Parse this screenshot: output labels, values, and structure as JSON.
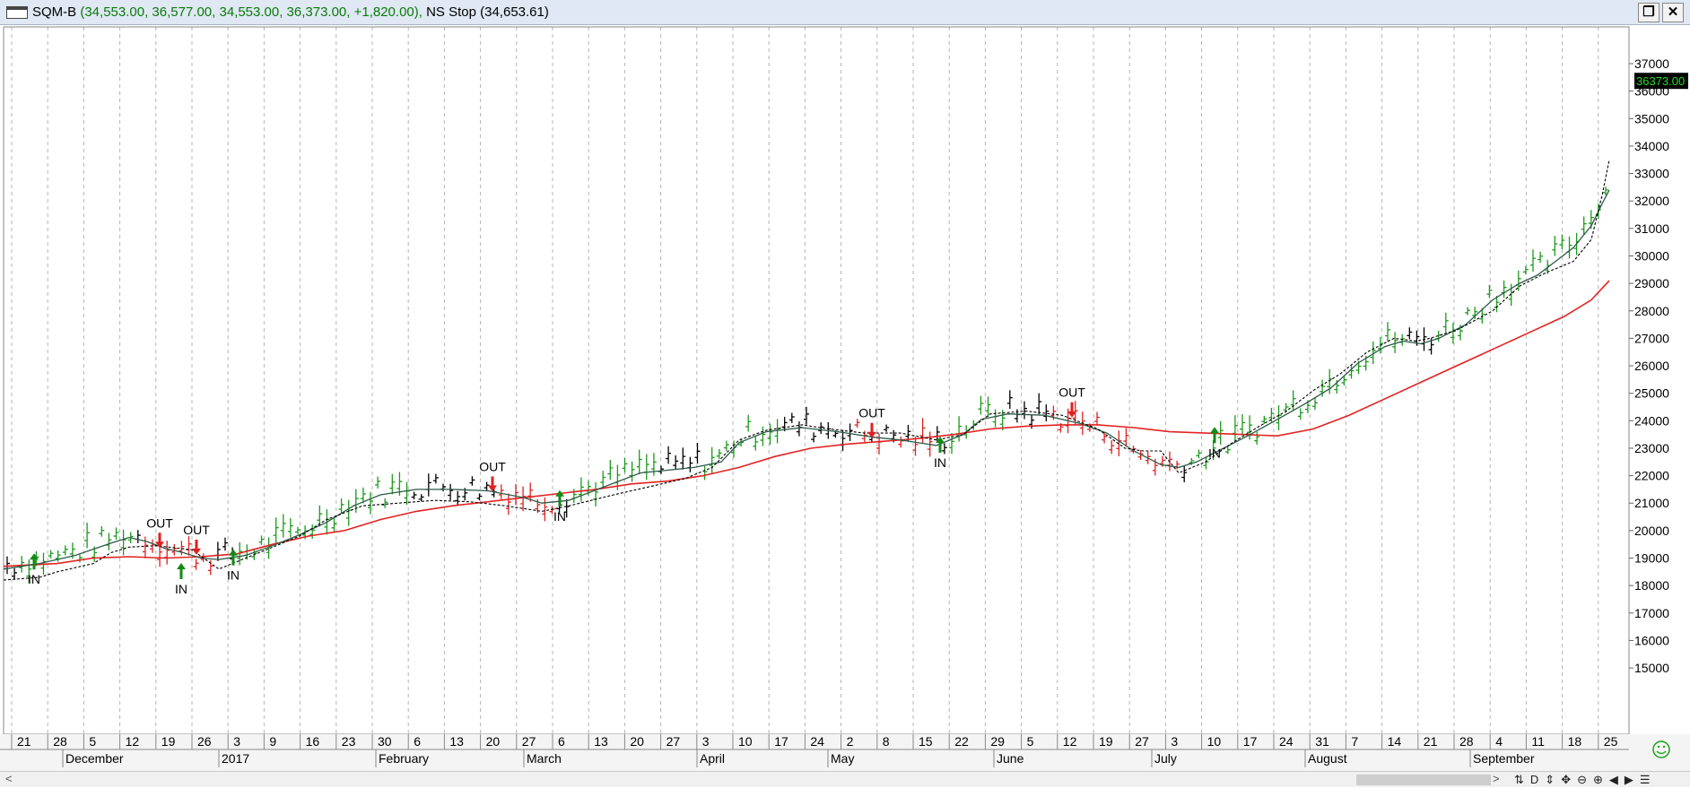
{
  "window": {
    "symbol": "SQM-B",
    "ohlc": "(34,553.00, 36,577.00, 34,553.00, 36,373.00, +1,820.00),",
    "indicator": "NS Stop (34,653.61)",
    "restore_icon": "restore-icon",
    "close_icon": "close-icon"
  },
  "colors": {
    "up_bar": "#1a9a1a",
    "down_bar": "#e02020",
    "neutral_bar": "#000000",
    "ma_long": "#e32222",
    "ma_short": "#2d5a4a",
    "stop_line": "#000000",
    "signal_in": "#138a13",
    "signal_out": "#e02020",
    "last_price_bg": "#000000",
    "last_price_fg": "#22dd22",
    "grid": "#b4b4b4"
  },
  "price_axis": {
    "labels": [
      "15000",
      "16000",
      "17000",
      "18000",
      "19000",
      "20000",
      "21000",
      "22000",
      "23000",
      "24000",
      "25000",
      "26000",
      "27000",
      "28000",
      "29000",
      "30000",
      "31000",
      "32000",
      "33000",
      "34000",
      "35000",
      "36000",
      "37000"
    ],
    "last_price_label": "36373.00"
  },
  "time_axis": {
    "day_labels": [
      "21",
      "28",
      "5",
      "12",
      "19",
      "26",
      "3",
      "9",
      "16",
      "23",
      "30",
      "6",
      "13",
      "20",
      "27",
      "6",
      "13",
      "20",
      "27",
      "3",
      "10",
      "17",
      "24",
      "2",
      "8",
      "15",
      "22",
      "29",
      "5",
      "12",
      "19",
      "27",
      "3",
      "10",
      "17",
      "24",
      "31",
      "7",
      "14",
      "21",
      "28",
      "4",
      "11",
      "18",
      "25"
    ],
    "month_labels": [
      "December",
      "2017",
      "February",
      "March",
      "April",
      "May",
      "June",
      "July",
      "August",
      "September"
    ]
  },
  "signals": [
    {
      "type": "IN",
      "label": "IN",
      "x": 34,
      "y": 18650
    },
    {
      "type": "OUT",
      "label": "OUT",
      "x": 174,
      "y": 19400
    },
    {
      "type": "IN",
      "label": "IN",
      "x": 198,
      "y": 18300
    },
    {
      "type": "OUT",
      "label": "OUT",
      "x": 215,
      "y": 19150
    },
    {
      "type": "IN",
      "label": "IN",
      "x": 256,
      "y": 18800
    },
    {
      "type": "OUT",
      "label": "OUT",
      "x": 545,
      "y": 21450
    },
    {
      "type": "IN",
      "label": "IN",
      "x": 620,
      "y": 20950
    },
    {
      "type": "OUT",
      "label": "OUT",
      "x": 968,
      "y": 23400
    },
    {
      "type": "IN",
      "label": "IN",
      "x": 1044,
      "y": 22900
    },
    {
      "type": "OUT",
      "label": "OUT",
      "x": 1191,
      "y": 24150
    },
    {
      "type": "IN",
      "label": "IN",
      "x": 1350,
      "y": 23250
    }
  ],
  "chart_data": {
    "type": "bar",
    "title": "SQM-B",
    "y_range": [
      14400,
      37300
    ],
    "x_range": [
      0,
      1818
    ],
    "ma_short": [
      [
        0,
        18600
      ],
      [
        40,
        18800
      ],
      [
        80,
        19100
      ],
      [
        120,
        19550
      ],
      [
        140,
        19750
      ],
      [
        160,
        19600
      ],
      [
        180,
        19350
      ],
      [
        200,
        19200
      ],
      [
        220,
        19000
      ],
      [
        240,
        18950
      ],
      [
        270,
        19100
      ],
      [
        300,
        19450
      ],
      [
        330,
        19850
      ],
      [
        360,
        20300
      ],
      [
        390,
        20900
      ],
      [
        420,
        21300
      ],
      [
        460,
        21500
      ],
      [
        500,
        21500
      ],
      [
        540,
        21450
      ],
      [
        580,
        21200
      ],
      [
        600,
        21000
      ],
      [
        630,
        21100
      ],
      [
        670,
        21600
      ],
      [
        710,
        22100
      ],
      [
        740,
        22200
      ],
      [
        770,
        22300
      ],
      [
        800,
        22500
      ],
      [
        820,
        23200
      ],
      [
        850,
        23600
      ],
      [
        890,
        23750
      ],
      [
        930,
        23600
      ],
      [
        970,
        23400
      ],
      [
        1000,
        23300
      ],
      [
        1040,
        23100
      ],
      [
        1070,
        23500
      ],
      [
        1090,
        24050
      ],
      [
        1120,
        24250
      ],
      [
        1160,
        24200
      ],
      [
        1200,
        23900
      ],
      [
        1230,
        23550
      ],
      [
        1260,
        22900
      ],
      [
        1290,
        22400
      ],
      [
        1310,
        22300
      ],
      [
        1330,
        22500
      ],
      [
        1360,
        23000
      ],
      [
        1390,
        23500
      ],
      [
        1420,
        24050
      ],
      [
        1450,
        24600
      ],
      [
        1480,
        25200
      ],
      [
        1510,
        26100
      ],
      [
        1540,
        26700
      ],
      [
        1560,
        26900
      ],
      [
        1580,
        26800
      ],
      [
        1600,
        27000
      ],
      [
        1630,
        27500
      ],
      [
        1660,
        28400
      ],
      [
        1690,
        29000
      ],
      [
        1710,
        29300
      ],
      [
        1730,
        29800
      ],
      [
        1750,
        30300
      ],
      [
        1770,
        31100
      ],
      [
        1782,
        31900
      ],
      [
        1790,
        32400
      ]
    ],
    "stop_line": [
      [
        0,
        18200
      ],
      [
        40,
        18300
      ],
      [
        60,
        18500
      ],
      [
        100,
        18800
      ],
      [
        120,
        19200
      ],
      [
        140,
        19400
      ],
      [
        170,
        19450
      ],
      [
        210,
        19300
      ],
      [
        240,
        18600
      ],
      [
        270,
        19000
      ],
      [
        300,
        19400
      ],
      [
        330,
        19800
      ],
      [
        360,
        20400
      ],
      [
        400,
        20900
      ],
      [
        440,
        21000
      ],
      [
        480,
        21100
      ],
      [
        520,
        21050
      ],
      [
        560,
        20900
      ],
      [
        600,
        20700
      ],
      [
        630,
        20900
      ],
      [
        680,
        21300
      ],
      [
        720,
        21600
      ],
      [
        760,
        21900
      ],
      [
        790,
        22300
      ],
      [
        820,
        23300
      ],
      [
        850,
        23650
      ],
      [
        890,
        23850
      ],
      [
        920,
        23700
      ],
      [
        960,
        23550
      ],
      [
        1000,
        23550
      ],
      [
        1040,
        23300
      ],
      [
        1070,
        23500
      ],
      [
        1100,
        24250
      ],
      [
        1140,
        24350
      ],
      [
        1180,
        24200
      ],
      [
        1220,
        23700
      ],
      [
        1250,
        23000
      ],
      [
        1270,
        22900
      ],
      [
        1290,
        22900
      ],
      [
        1310,
        22100
      ],
      [
        1340,
        22500
      ],
      [
        1370,
        23200
      ],
      [
        1400,
        23800
      ],
      [
        1430,
        24350
      ],
      [
        1460,
        25100
      ],
      [
        1490,
        25700
      ],
      [
        1520,
        26500
      ],
      [
        1550,
        27000
      ],
      [
        1575,
        26900
      ],
      [
        1590,
        27000
      ],
      [
        1620,
        27300
      ],
      [
        1660,
        28000
      ],
      [
        1690,
        28900
      ],
      [
        1720,
        29400
      ],
      [
        1750,
        29800
      ],
      [
        1770,
        30600
      ],
      [
        1782,
        32200
      ],
      [
        1790,
        33500
      ]
    ],
    "ma_long": [
      [
        0,
        18700
      ],
      [
        60,
        18800
      ],
      [
        100,
        19000
      ],
      [
        140,
        19050
      ],
      [
        180,
        19000
      ],
      [
        220,
        19050
      ],
      [
        260,
        19150
      ],
      [
        300,
        19500
      ],
      [
        340,
        19800
      ],
      [
        380,
        20000
      ],
      [
        420,
        20400
      ],
      [
        460,
        20700
      ],
      [
        500,
        20900
      ],
      [
        540,
        21050
      ],
      [
        580,
        21200
      ],
      [
        620,
        21350
      ],
      [
        660,
        21500
      ],
      [
        700,
        21700
      ],
      [
        740,
        21800
      ],
      [
        780,
        22000
      ],
      [
        820,
        22300
      ],
      [
        860,
        22700
      ],
      [
        900,
        23000
      ],
      [
        940,
        23150
      ],
      [
        980,
        23250
      ],
      [
        1020,
        23350
      ],
      [
        1060,
        23500
      ],
      [
        1100,
        23700
      ],
      [
        1140,
        23800
      ],
      [
        1180,
        23850
      ],
      [
        1220,
        23850
      ],
      [
        1260,
        23750
      ],
      [
        1300,
        23600
      ],
      [
        1340,
        23550
      ],
      [
        1380,
        23500
      ],
      [
        1420,
        23450
      ],
      [
        1460,
        23700
      ],
      [
        1500,
        24200
      ],
      [
        1540,
        24800
      ],
      [
        1580,
        25400
      ],
      [
        1620,
        26000
      ],
      [
        1660,
        26600
      ],
      [
        1700,
        27200
      ],
      [
        1740,
        27800
      ],
      [
        1770,
        28400
      ],
      [
        1790,
        29100
      ]
    ]
  }
}
